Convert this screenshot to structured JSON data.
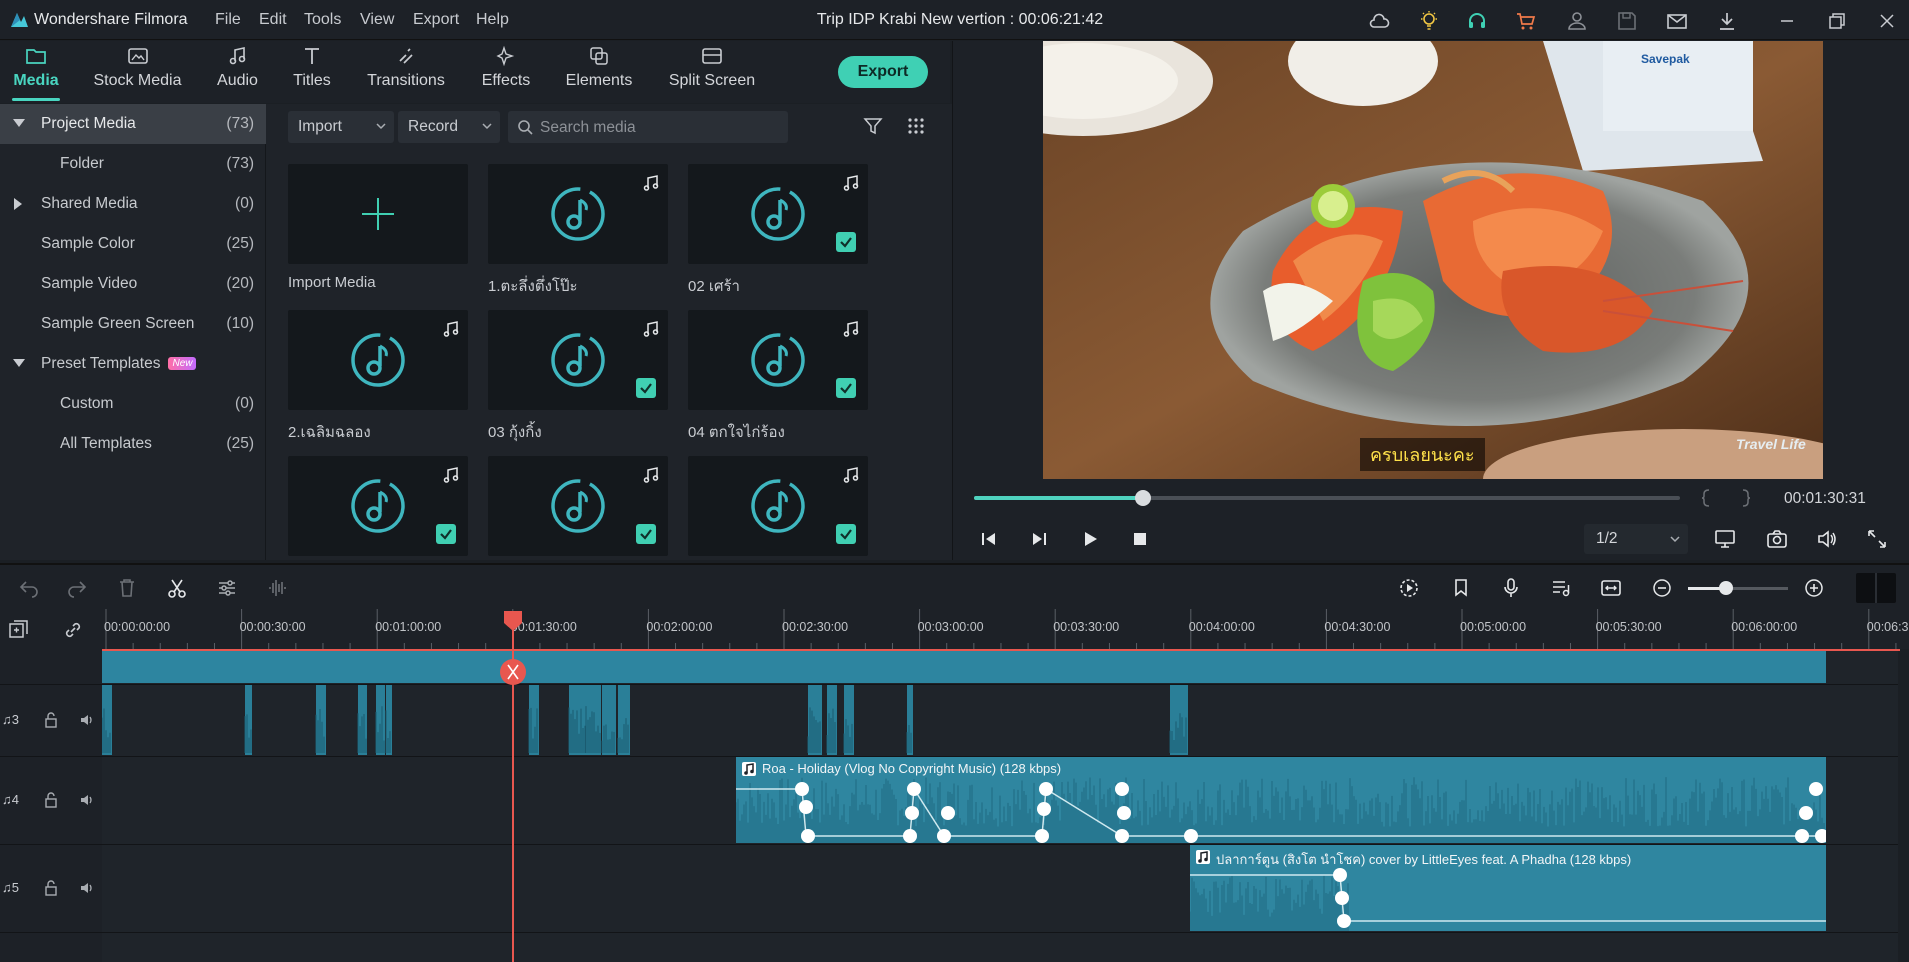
{
  "app": {
    "name": "Wondershare Filmora",
    "menu": [
      "File",
      "Edit",
      "Tools",
      "View",
      "Export",
      "Help"
    ],
    "doc_title": "Trip IDP Krabi New vertion : 00:06:21:42"
  },
  "tabs": [
    {
      "label": "Media",
      "icon": "folder-icon",
      "active": true
    },
    {
      "label": "Stock Media",
      "icon": "image-icon"
    },
    {
      "label": "Audio",
      "icon": "music-note-icon"
    },
    {
      "label": "Titles",
      "icon": "text-icon"
    },
    {
      "label": "Transitions",
      "icon": "transition-icon"
    },
    {
      "label": "Effects",
      "icon": "sparkle-icon"
    },
    {
      "label": "Elements",
      "icon": "elements-icon"
    },
    {
      "label": "Split Screen",
      "icon": "split-screen-icon"
    }
  ],
  "export_label": "Export",
  "left_panel": {
    "items": [
      {
        "name": "Project Media",
        "count": "(73)"
      },
      {
        "name": "Folder",
        "count": "(73)"
      },
      {
        "name": "Shared Media",
        "count": "(0)"
      },
      {
        "name": "Sample Color",
        "count": "(25)"
      },
      {
        "name": "Sample Video",
        "count": "(20)"
      },
      {
        "name": "Sample Green Screen",
        "count": "(10)"
      },
      {
        "name": "Preset Templates",
        "count": "",
        "badge": "New"
      },
      {
        "name": "Custom",
        "count": "(0)"
      },
      {
        "name": "All Templates",
        "count": "(25)"
      }
    ]
  },
  "media": {
    "import_label": "Import",
    "record_label": "Record",
    "search_placeholder": "Search media",
    "tiles": [
      {
        "label": "Import Media",
        "type": "import"
      },
      {
        "label": "1.ตะลึ่งตึ่งโป๊ะ",
        "checked": false
      },
      {
        "label": "02 เศร้า",
        "checked": true
      },
      {
        "label": "2.เฉลิมฉลอง",
        "checked": false
      },
      {
        "label": "03 กุ้งกิ้ง",
        "checked": true
      },
      {
        "label": "04 ตกใจไก่ร้อง",
        "checked": true
      },
      {
        "label": "",
        "checked": true
      },
      {
        "label": "",
        "checked": true
      },
      {
        "label": "",
        "checked": true
      }
    ]
  },
  "preview": {
    "subtitle": "ครบเลยนะคะ",
    "watermark": "Travel Life",
    "progress": 0.24,
    "timecode": "00:01:30:31",
    "ratio": "1/2"
  },
  "timeline": {
    "ruler": [
      "00:00:00:00",
      "00:00:30:00",
      "00:01:00:00",
      "00:01:30:00",
      "00:02:00:00",
      "00:02:30:00",
      "00:03:00:00",
      "00:03:30:00",
      "00:04:00:00",
      "00:04:30:00",
      "00:05:00:00",
      "00:05:30:00",
      "00:06:00:00",
      "00:06:3"
    ],
    "tracks": [
      {
        "id": "3"
      },
      {
        "id": "4",
        "clip": "Roa - Holiday (Vlog No Copyright Music) (128 kbps)"
      },
      {
        "id": "5",
        "clip": "ปลาการ์ตูน (สิงโต นำโชค) cover by LittleEyes feat. A Phadha (128 kbps)"
      }
    ]
  },
  "colors": {
    "accent": "#49d5c0",
    "clip": "#2f86a0",
    "playhead": "#e8574f"
  }
}
